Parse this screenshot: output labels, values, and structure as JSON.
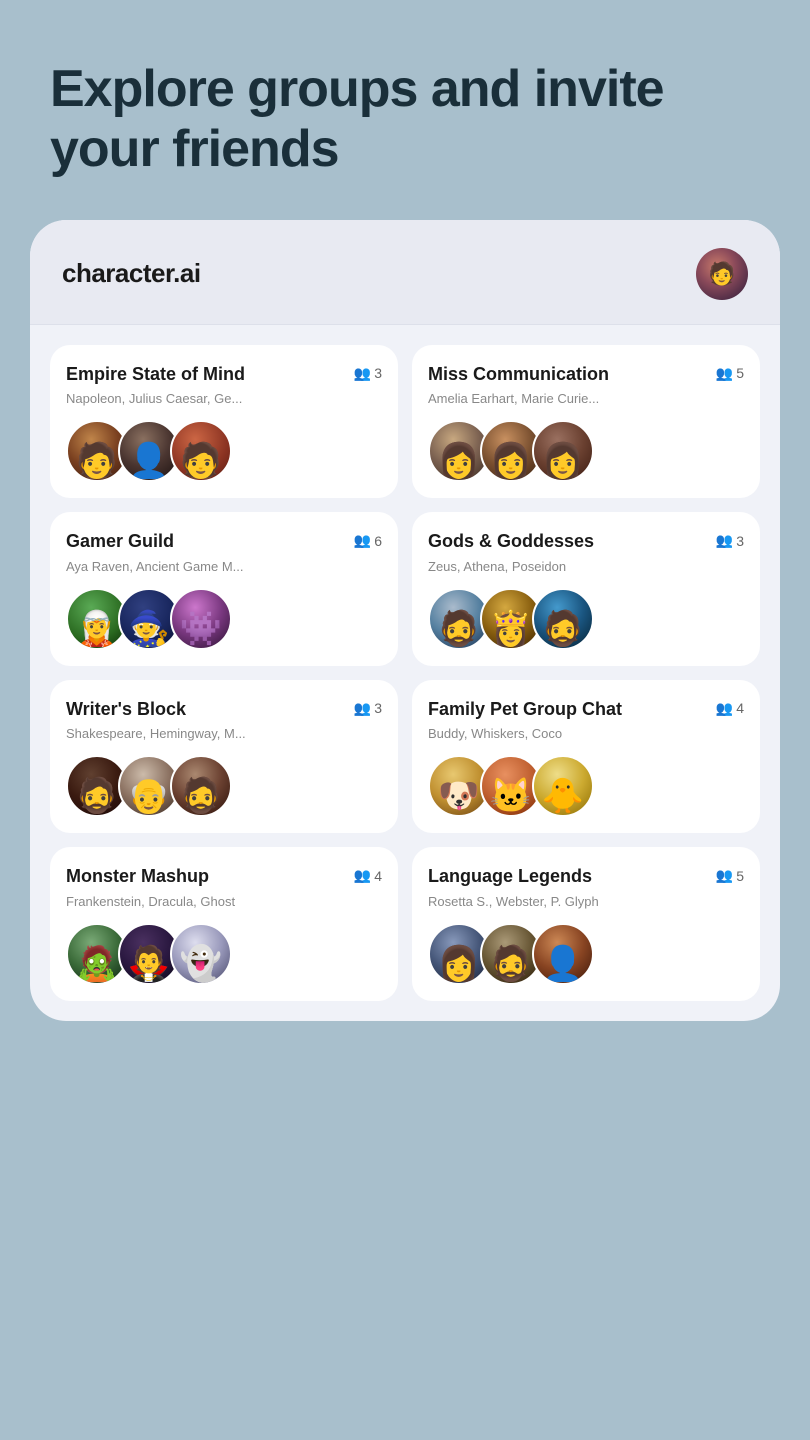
{
  "hero": {
    "title": "Explore groups and invite your friends"
  },
  "header": {
    "logo": "character.ai"
  },
  "groups": [
    {
      "id": "empire",
      "title": "Empire State of Mind",
      "members_count": "3",
      "members_text": "Napoleon, Julius Caesar, Ge...",
      "avatars": [
        "av-napoleon",
        "av-caesar",
        "av-napoleon2"
      ],
      "faces": [
        "🧑",
        "👤",
        "🧑"
      ]
    },
    {
      "id": "miss-comm",
      "title": "Miss Communication",
      "members_count": "5",
      "members_text": "Amelia Earhart, Marie Curie...",
      "avatars": [
        "av-amelia",
        "av-curie",
        "av-woman3"
      ],
      "faces": [
        "👩",
        "👩",
        "👩"
      ]
    },
    {
      "id": "gamer",
      "title": "Gamer Guild",
      "members_count": "6",
      "members_text": "Aya Raven, Ancient Game M...",
      "avatars": [
        "av-aya",
        "av-ancient",
        "av-gamer"
      ],
      "faces": [
        "🧝",
        "🧙",
        "👾"
      ]
    },
    {
      "id": "gods",
      "title": "Gods & Goddesses",
      "members_count": "3",
      "members_text": "Zeus, Athena, Poseidon",
      "avatars": [
        "av-zeus",
        "av-athena",
        "av-poseidon"
      ],
      "faces": [
        "🧔",
        "👸",
        "🧔"
      ]
    },
    {
      "id": "writers",
      "title": "Writer's Block",
      "members_count": "3",
      "members_text": "Shakespeare, Hemingway, M...",
      "avatars": [
        "av-shakespeare",
        "av-hemingway",
        "av-mark"
      ],
      "faces": [
        "🧔",
        "👴",
        "🧔"
      ]
    },
    {
      "id": "family-pet",
      "title": "Family Pet Group Chat",
      "members_count": "4",
      "members_text": "Buddy, Whiskers, Coco",
      "avatars": [
        "av-buddy",
        "av-whiskers",
        "av-coco"
      ],
      "faces": [
        "🐶",
        "🐱",
        "🐥"
      ]
    },
    {
      "id": "monster",
      "title": "Monster Mashup",
      "members_count": "4",
      "members_text": "Frankenstein, Dracula, Ghost",
      "avatars": [
        "av-frankenstein",
        "av-dracula",
        "av-ghost"
      ],
      "faces": [
        "🧟",
        "🧛",
        "👻"
      ]
    },
    {
      "id": "language",
      "title": "Language Legends",
      "members_count": "5",
      "members_text": "Rosetta S., Webster, P. Glyph",
      "avatars": [
        "av-rosetta",
        "av-webster",
        "av-pglyph"
      ],
      "faces": [
        "👩",
        "🧔",
        "👤"
      ]
    }
  ]
}
